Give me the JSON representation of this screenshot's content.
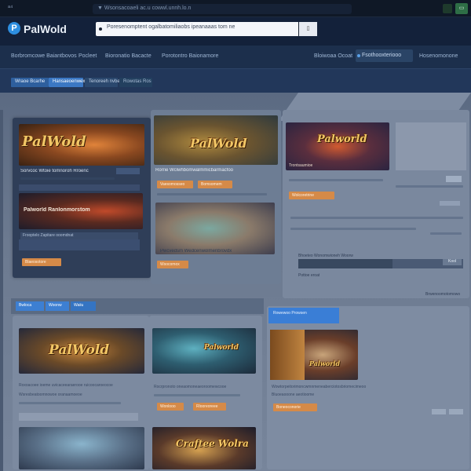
{
  "chrome": {
    "label": "ᵃ⁴",
    "url": "▼ Wsonsacoaeli ac.u cowwl.unnh.lo.n",
    "action_label": "▭"
  },
  "header": {
    "logo_letter": "P",
    "logo_text": "PalWold",
    "search_text": "Poresenomptent ogalbatomiliaobs ipeanaaas tom ne",
    "search_button": "▯"
  },
  "nav": {
    "links": [
      "Borbromcowe Baiantbovos",
      "Pocleet",
      "Bioronatio Bacacte",
      "Porotontro Baionamore",
      "Bloiwoaa Ocoat",
      "Hosenomonone"
    ],
    "pill": "Fsothooxteriooo"
  },
  "filters": [
    "Wraoe Bcarhe",
    "Hansaeoenwex",
    "Tenoreeh nvbe",
    "Rowotas Ros"
  ],
  "cards": {
    "card1": {
      "thumb_title": "PalWold",
      "thumb2_title": "Palworld Ranlonmorstom",
      "title": "Sorvcoc Wtoie tomnoroh Rroenc",
      "sub": "Frooptelo Zapitare ooomdnat",
      "button": "Blaeosotore"
    },
    "card2": {
      "thumb_title": "PalWold",
      "title": "Rorrie Wclwhbomwalmmicbarmacfoo",
      "button_a": "Vaesomosseo",
      "button_b": "Bomsomem",
      "caption": "Pwcvedsm Wedcenwolmenbrovdx",
      "button_c": "Wsocomox"
    },
    "card3": {
      "thumb_title": "Palworld",
      "label": "Trontsaumioe",
      "button": "Wolcoretrine",
      "row_a": "Bhoeteo Wonomwioneh Woorw",
      "row_b": "Pottoe eroat",
      "row_c": "Brwenoomotomowo",
      "chip": "Kool"
    },
    "lower_tabs": [
      "Bwloca",
      "Woonw",
      "Waiiu"
    ],
    "card4": {
      "thumb_title": "PalWold",
      "desc": "Roxoacoee ioeme uvicaceearaerooe ruicoocaroeocoe",
      "desc2": "Wsresbeatoomnowoe oranaamoeoe"
    },
    "card5": {
      "thumb_title": "Palworld",
      "thumb2_title": "Craftee Wolra",
      "desc": "Rocrpronoto oneaomoneaeoroomewcooe",
      "button": "Wonlooo",
      "button_b": "Rlooreoreee"
    },
    "card6": {
      "head": "Rowewoo Prowsen",
      "thumb_title": "Palworld",
      "desc": "Wowtorpeitorimoncwmnmeneaberciotosbriomecimeoo",
      "desc2": "Bluoeaooone aeotioome",
      "button": "Boneoconorie"
    }
  }
}
